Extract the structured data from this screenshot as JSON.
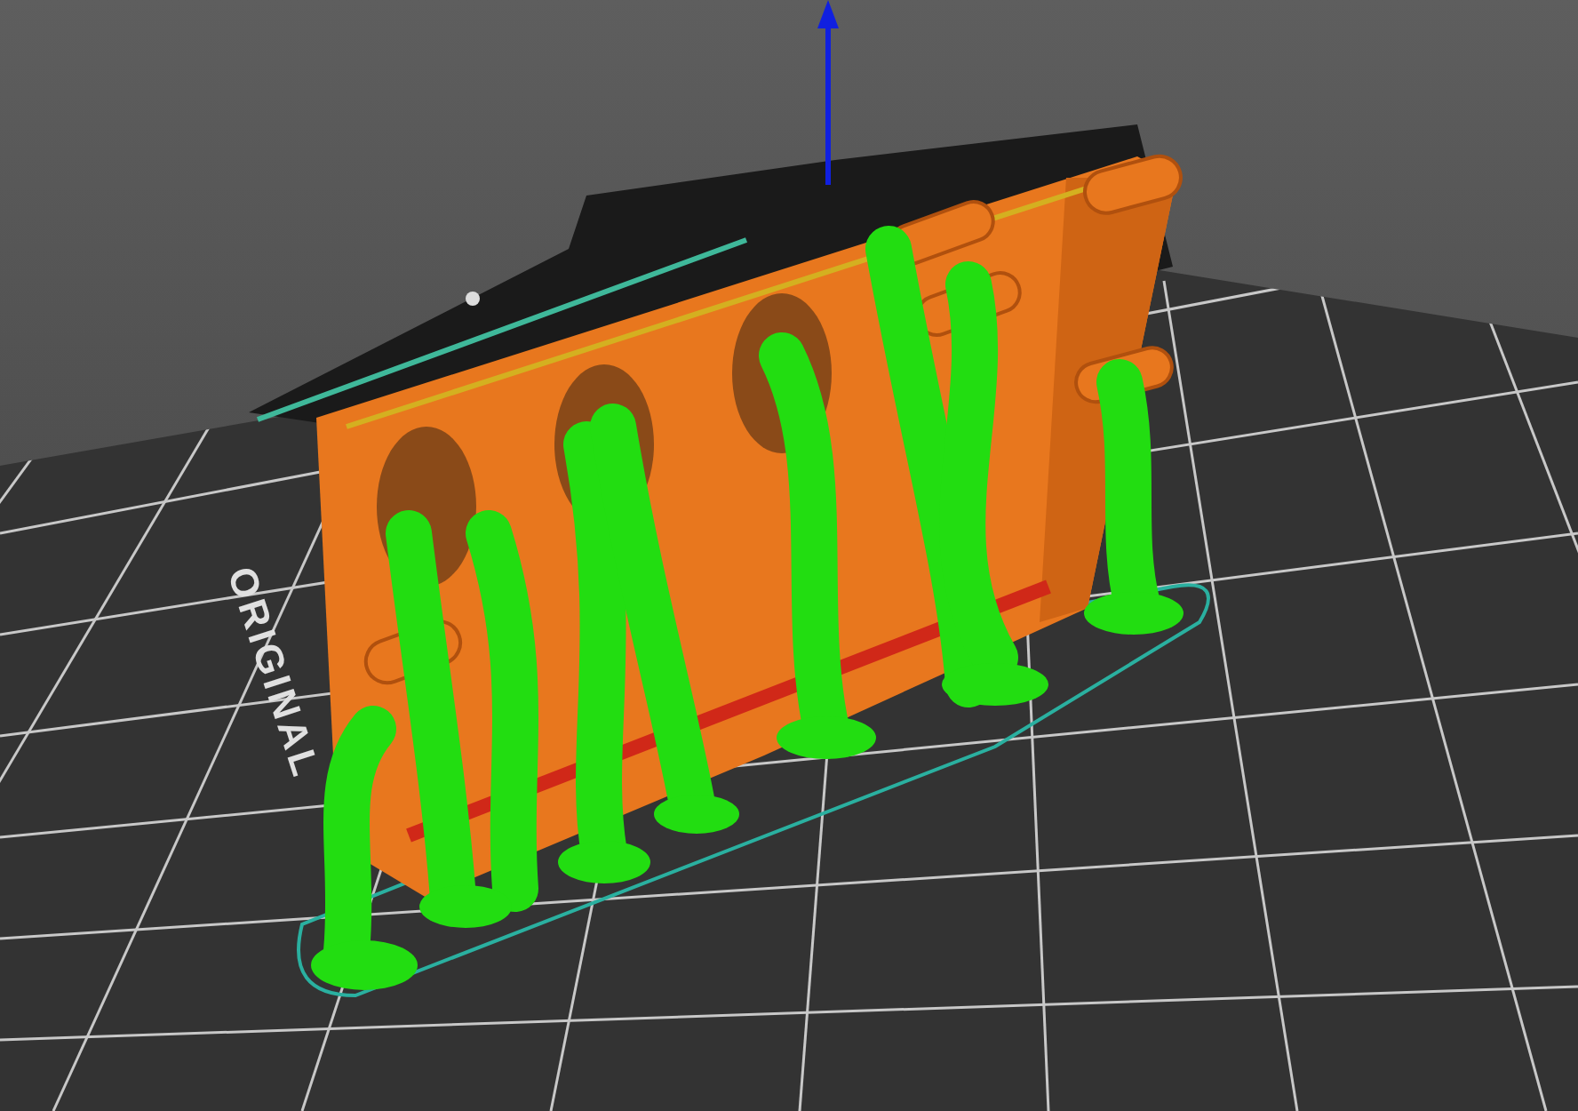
{
  "bed_label": {
    "text": "ORIGINAL"
  }
}
